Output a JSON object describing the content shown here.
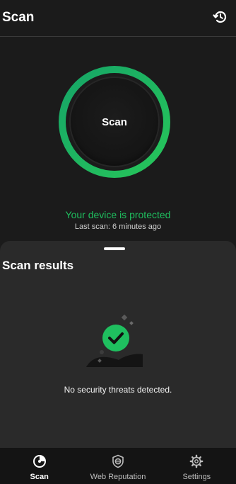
{
  "header": {
    "title": "Scan",
    "history_icon": "history-icon"
  },
  "scan_button": {
    "label": "Scan"
  },
  "status": {
    "message": "Your device is protected",
    "last_scan": "Last scan: 6 minutes ago",
    "color": "#1fbf5f"
  },
  "results": {
    "title": "Scan results",
    "message": "No security threats detected.",
    "icon": "check-circle-icon"
  },
  "bottom_nav": {
    "items": [
      {
        "label": "Scan",
        "icon": "scan-icon",
        "active": true
      },
      {
        "label": "Web Reputation",
        "icon": "shield-globe-icon",
        "active": false
      },
      {
        "label": "Settings",
        "icon": "gear-icon",
        "active": false
      }
    ]
  },
  "colors": {
    "accent": "#1fbf5f",
    "background": "#1b1b1b",
    "sheet": "#2a2a2a"
  }
}
